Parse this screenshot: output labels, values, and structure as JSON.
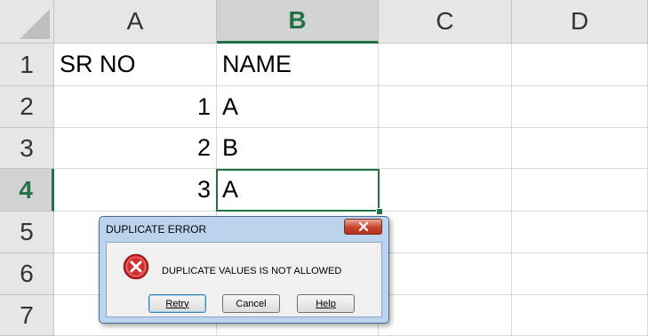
{
  "columns": [
    "A",
    "B",
    "C",
    "D"
  ],
  "selected_column": "B",
  "rows": [
    "1",
    "2",
    "3",
    "4",
    "5",
    "6",
    "7"
  ],
  "selected_row": "4",
  "cells": {
    "A1": "SR NO",
    "B1": "NAME",
    "A2": "1",
    "B2": "A",
    "A3": "2",
    "B3": "B",
    "A4": "3",
    "B4": "A"
  },
  "dialog": {
    "title": "DUPLICATE ERROR",
    "message": "DUPLICATE VALUES IS NOT ALLOWED",
    "buttons": {
      "retry": "Retry",
      "cancel": "Cancel",
      "help": "Help"
    },
    "icon": "error-icon"
  },
  "colors": {
    "accent": "#217346",
    "error": "#d22f2f"
  }
}
